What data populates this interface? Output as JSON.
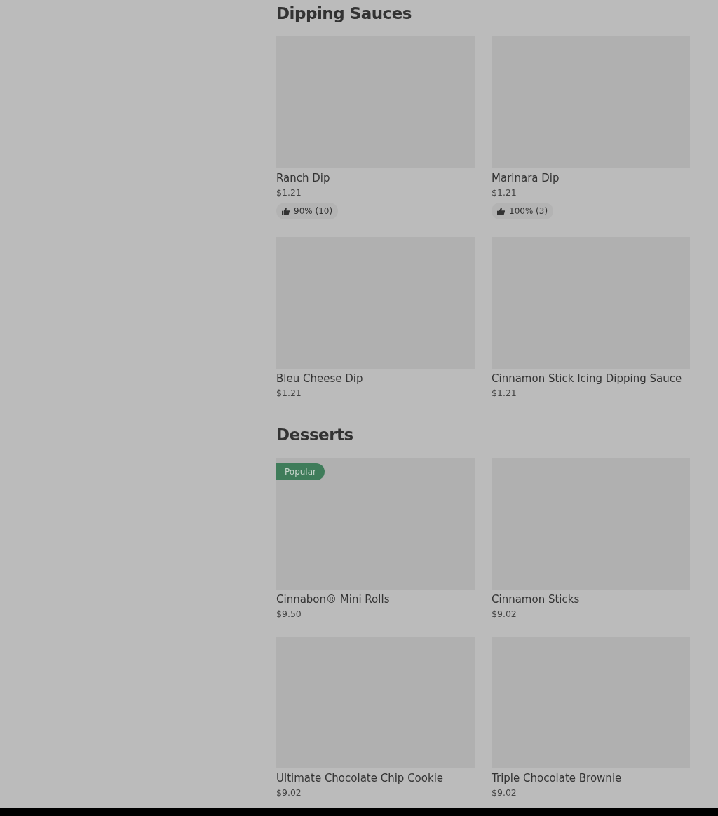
{
  "sections": [
    {
      "title": "Dipping Sauces",
      "items": [
        {
          "name": "Ranch Dip",
          "price": "$1.21",
          "rating": "90% (10)"
        },
        {
          "name": "Marinara Dip",
          "price": "$1.21",
          "rating": "100% (3)"
        },
        {
          "name": "Bleu Cheese Dip",
          "price": "$1.21"
        },
        {
          "name": "Cinnamon Stick Icing Dipping Sauce",
          "price": "$1.21"
        }
      ]
    },
    {
      "title": "Desserts",
      "items": [
        {
          "name": "Cinnabon® Mini Rolls",
          "price": "$9.50",
          "badge": "Popular"
        },
        {
          "name": "Cinnamon Sticks",
          "price": "$9.02"
        },
        {
          "name": "Ultimate Chocolate Chip Cookie",
          "price": "$9.02"
        },
        {
          "name": "Triple Chocolate Brownie",
          "price": "$9.02"
        }
      ]
    }
  ]
}
